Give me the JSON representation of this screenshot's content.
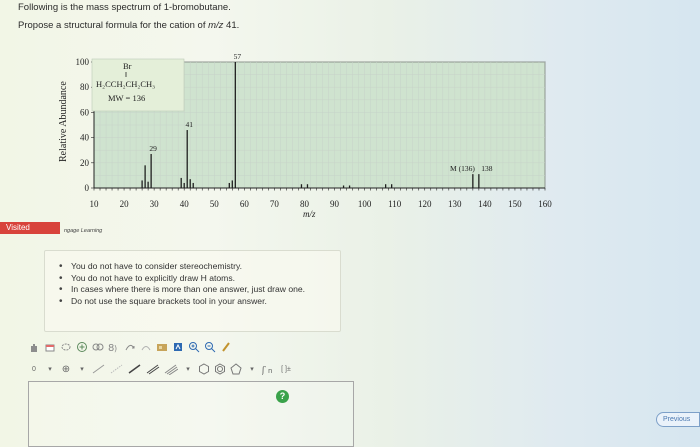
{
  "question": {
    "line1": "Following is the mass spectrum of 1-bromobutane.",
    "line2_prefix": "Propose a structural formula for the cation of ",
    "line2_var": "m/z",
    "line2_suffix": " 41."
  },
  "structure": {
    "top": "Br",
    "formula": "H₂CCH₂CH₂CH₃",
    "mw": "MW = 136"
  },
  "chart_data": {
    "type": "bar",
    "xlabel": "m/z",
    "ylabel": "Relative Abundance",
    "xlim": [
      10,
      160
    ],
    "ylim": [
      0,
      100
    ],
    "xticks": [
      10,
      20,
      30,
      40,
      50,
      60,
      70,
      80,
      90,
      100,
      110,
      120,
      130,
      140,
      150,
      160
    ],
    "yticks": [
      0,
      20,
      40,
      60,
      80,
      100
    ],
    "peaks": [
      {
        "x": 26,
        "y": 6
      },
      {
        "x": 27,
        "y": 18
      },
      {
        "x": 28,
        "y": 5
      },
      {
        "x": 29,
        "y": 27
      },
      {
        "x": 39,
        "y": 8
      },
      {
        "x": 40,
        "y": 4
      },
      {
        "x": 41,
        "y": 46
      },
      {
        "x": 42,
        "y": 7
      },
      {
        "x": 43,
        "y": 4
      },
      {
        "x": 55,
        "y": 4
      },
      {
        "x": 56,
        "y": 6
      },
      {
        "x": 57,
        "y": 100
      },
      {
        "x": 79,
        "y": 3
      },
      {
        "x": 81,
        "y": 3
      },
      {
        "x": 93,
        "y": 2
      },
      {
        "x": 95,
        "y": 2
      },
      {
        "x": 107,
        "y": 3
      },
      {
        "x": 109,
        "y": 3
      },
      {
        "x": 136,
        "y": 11
      },
      {
        "x": 138,
        "y": 11
      }
    ],
    "annotations": [
      {
        "text": "57",
        "x": 57
      },
      {
        "text": "41",
        "x": 41
      },
      {
        "text": "29",
        "x": 29
      },
      {
        "text": "M (136)",
        "x": 136
      },
      {
        "text": "138",
        "x": 138
      }
    ],
    "colors": {
      "bars": "#1f1f1f",
      "plot_bg": "#cfe3cf",
      "grid": "#c7d3c9"
    }
  },
  "badge": {
    "visited": "Visited"
  },
  "credit": "ngage Learning",
  "notes": [
    "You do not have to consider stereochemistry.",
    "You do not have to explicitly draw H atoms.",
    "In cases where there is more than one answer, just draw one.",
    "Do not use the square brackets tool in your answer."
  ],
  "tools": {
    "row1": [
      "hand",
      "eraser",
      "charge-plus",
      "template-ring",
      "atom-map",
      "arc-arrow",
      "curved-arrow",
      "grid",
      "clean",
      "zoom-in",
      "zoom-out",
      "color"
    ],
    "row2_labels": {
      "charge": "0",
      "plus": "⊕",
      "bracket": "[ ]±"
    }
  },
  "help_label": "?",
  "prev_label": "Previous"
}
